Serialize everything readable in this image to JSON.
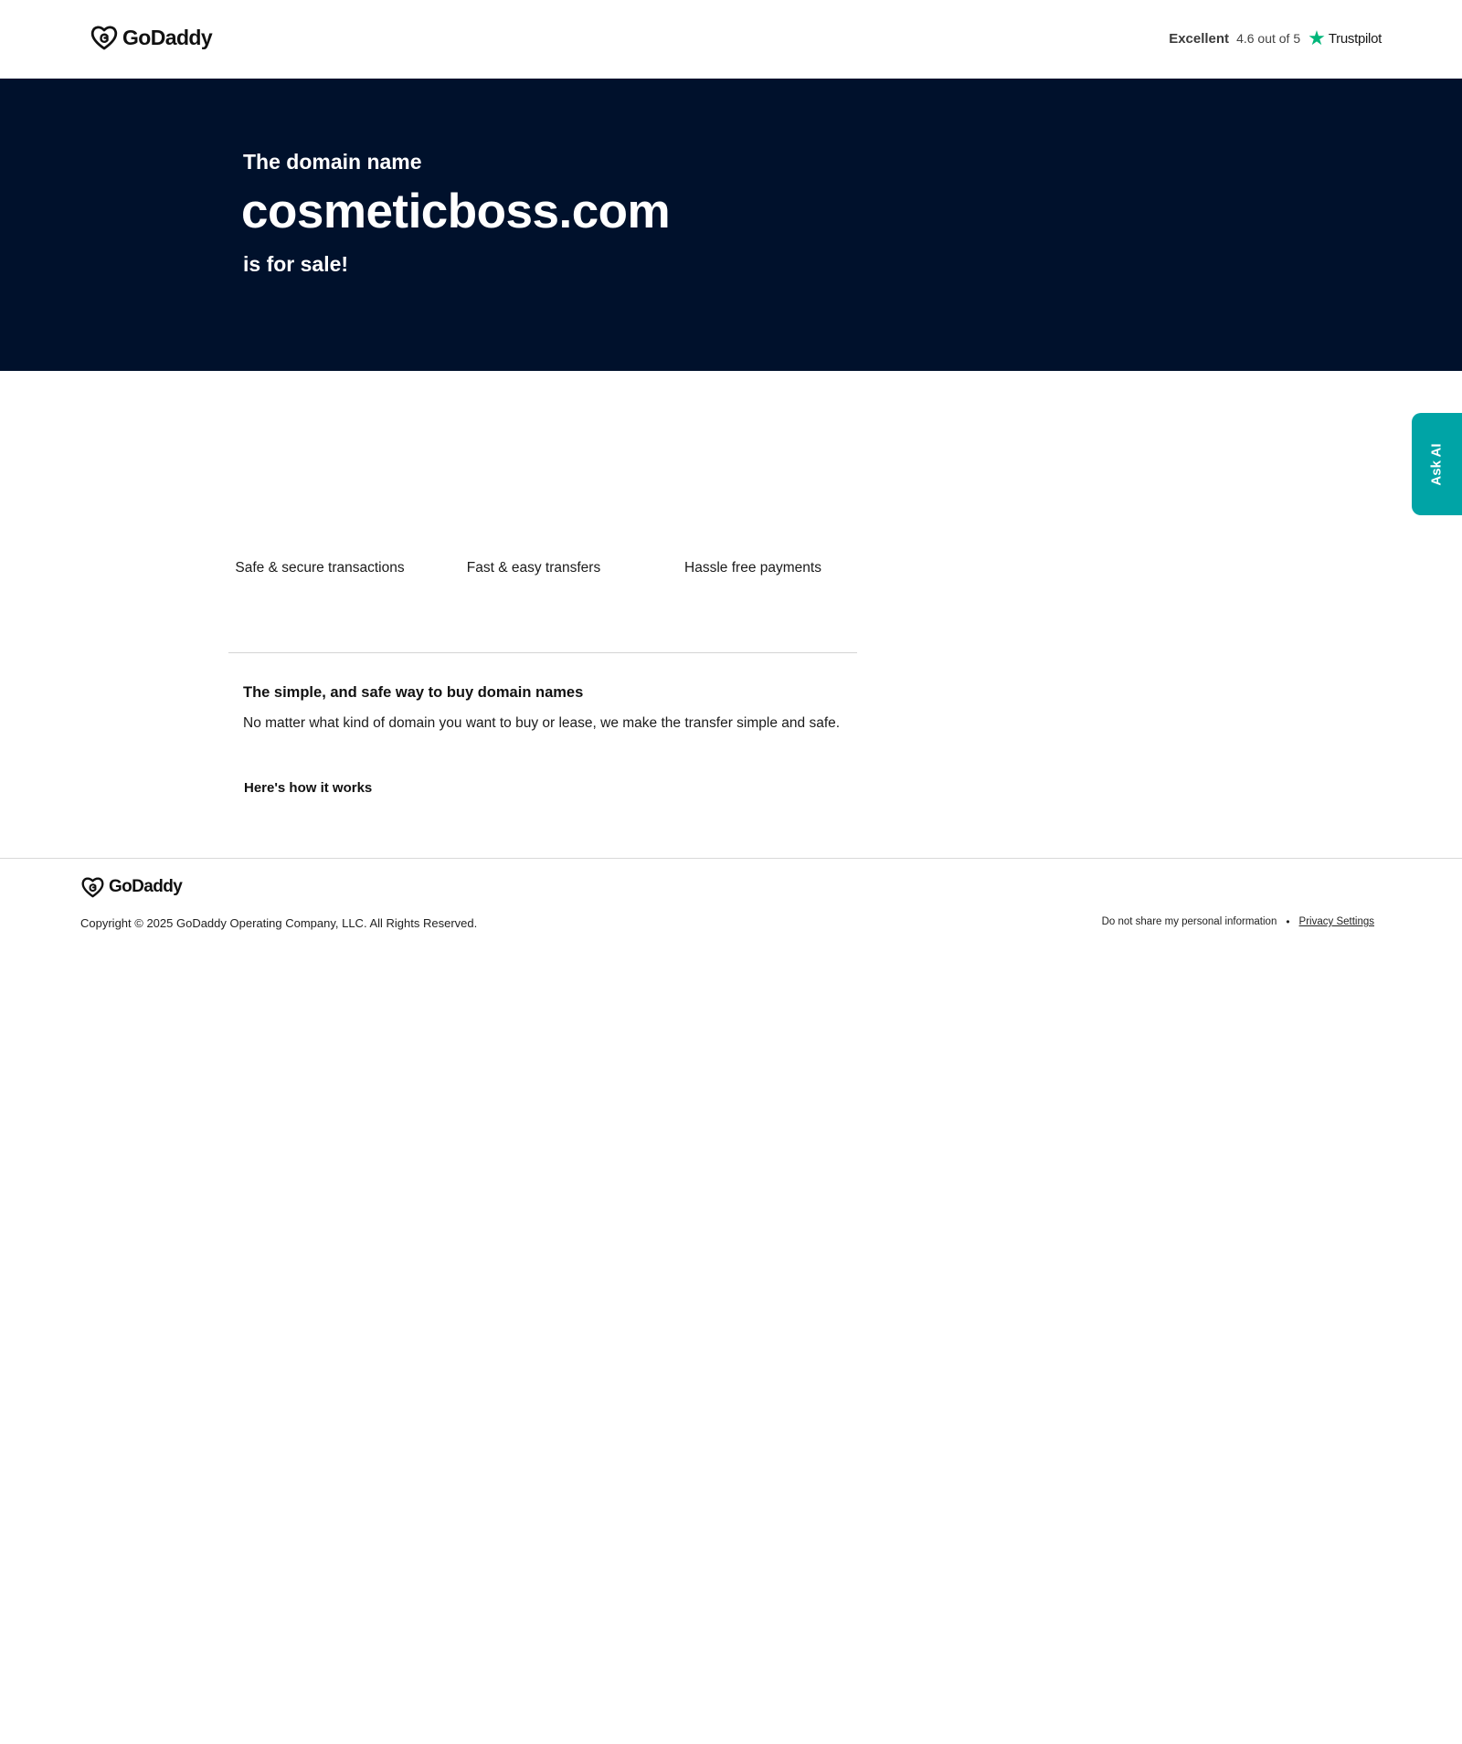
{
  "header": {
    "logo_text": "GoDaddy",
    "rating": {
      "label": "Excellent",
      "score_text": "4.6 out of 5",
      "provider": "Trustpilot",
      "star_icon": "star-icon",
      "star_color": "#00b67a"
    }
  },
  "hero": {
    "pre": "The domain name",
    "domain": "cosmeticboss.com",
    "post": "is for sale!",
    "background": "#00112c"
  },
  "ask_ai": {
    "label": "Ask AI",
    "color": "#00a4a6"
  },
  "features": [
    {
      "label": "Safe & secure transactions"
    },
    {
      "label": "Fast & easy transfers"
    },
    {
      "label": "Hassle free payments"
    }
  ],
  "info": {
    "title": "The simple, and safe way to buy domain names",
    "body": "No matter what kind of domain you want to buy or lease, we make the transfer simple and safe.",
    "link": "Here's how it works"
  },
  "footer": {
    "logo_text": "GoDaddy",
    "copyright": "Copyright © 2025 GoDaddy Operating Company, LLC. All Rights Reserved.",
    "links": {
      "do_not_share": "Do not share my personal information",
      "separator": "•",
      "privacy": "Privacy Settings"
    }
  }
}
